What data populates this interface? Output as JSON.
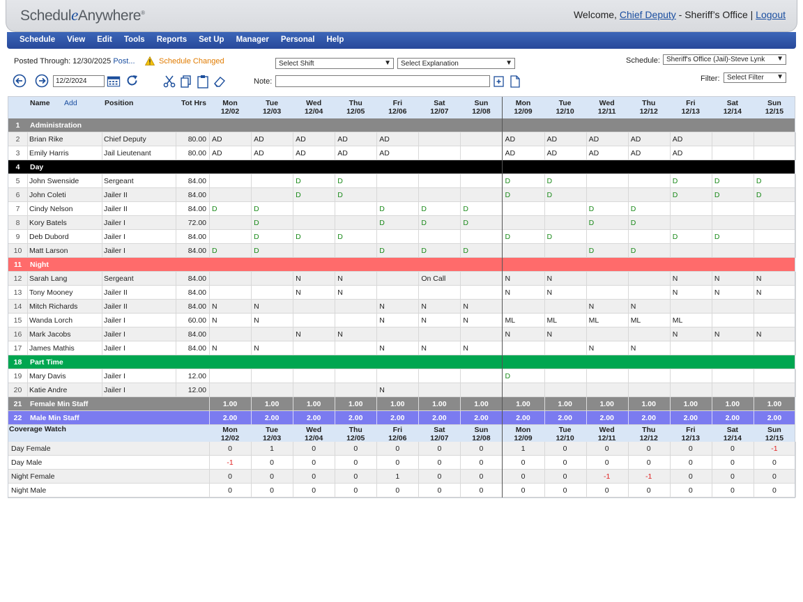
{
  "app": {
    "logo_main": "Schedul",
    "logo_e": "e",
    "logo_rest": "Anywhere",
    "logo_reg": "®",
    "welcome_prefix": "Welcome, ",
    "user_name": "Chief Deputy",
    "org_suffix": " - Sheriff’s Office | ",
    "logout": "Logout"
  },
  "menu": [
    "Schedule",
    "View",
    "Edit",
    "Tools",
    "Reports",
    "Set Up",
    "Manager",
    "Personal",
    "Help"
  ],
  "toolbar": {
    "posted_through_label": "Posted Through:",
    "posted_through_date": "12/30/2025",
    "post_link": "Post...",
    "warning_icon": "warning-icon",
    "schedule_changed": "Schedule Changed",
    "select_shift": "Select Shift",
    "select_explanation": "Select Explanation",
    "schedule_label": "Schedule:",
    "schedule_value": "Sheriff's Office (Jail)-Steve Lynk",
    "filter_label": "Filter:",
    "filter_value": "Select Filter",
    "date_value": "12/2/2024",
    "note_label": "Note:",
    "note_value": ""
  },
  "grid": {
    "headers": {
      "name": "Name",
      "add": "Add",
      "position": "Position",
      "tot_hrs": "Tot Hrs"
    },
    "days": [
      [
        "Mon",
        "12/02"
      ],
      [
        "Tue",
        "12/03"
      ],
      [
        "Wed",
        "12/04"
      ],
      [
        "Thu",
        "12/05"
      ],
      [
        "Fri",
        "12/06"
      ],
      [
        "Sat",
        "12/07"
      ],
      [
        "Sun",
        "12/08"
      ],
      [
        "Mon",
        "12/09"
      ],
      [
        "Tue",
        "12/10"
      ],
      [
        "Wed",
        "12/11"
      ],
      [
        "Thu",
        "12/12"
      ],
      [
        "Fri",
        "12/13"
      ],
      [
        "Sat",
        "12/14"
      ],
      [
        "Sun",
        "12/15"
      ]
    ],
    "rows": [
      {
        "type": "group",
        "num": "1",
        "label": "Administration",
        "color": "#888888"
      },
      {
        "type": "emp",
        "num": "2",
        "name": "Brian Rike",
        "position": "Chief Deputy",
        "hrs": "80.00",
        "cells": [
          "AD",
          "AD",
          "AD",
          "AD",
          "AD",
          "",
          "",
          "AD",
          "AD",
          "AD",
          "AD",
          "AD",
          "",
          ""
        ],
        "cls": ""
      },
      {
        "type": "emp",
        "num": "3",
        "name": "Emily Harris",
        "position": "Jail Lieutenant",
        "hrs": "80.00",
        "cells": [
          "AD",
          "AD",
          "AD",
          "AD",
          "AD",
          "",
          "",
          "AD",
          "AD",
          "AD",
          "AD",
          "AD",
          "",
          ""
        ],
        "cls": ""
      },
      {
        "type": "group",
        "num": "4",
        "label": "Day",
        "color": "#000000"
      },
      {
        "type": "emp",
        "num": "5",
        "name": "John Swenside",
        "position": "Sergeant",
        "hrs": "84.00",
        "cells": [
          "",
          "",
          "D",
          "D",
          "",
          "",
          "",
          "D",
          "D",
          "",
          "",
          "D",
          "D",
          "D"
        ],
        "cls": "green"
      },
      {
        "type": "emp",
        "num": "6",
        "name": "John Coleti",
        "position": "Jailer II",
        "hrs": "84.00",
        "cells": [
          "",
          "",
          "D",
          "D",
          "",
          "",
          "",
          "D",
          "D",
          "",
          "",
          "D",
          "D",
          "D"
        ],
        "cls": "green"
      },
      {
        "type": "emp",
        "num": "7",
        "name": "Cindy Nelson",
        "position": "Jailer II",
        "hrs": "84.00",
        "cells": [
          "D",
          "D",
          "",
          "",
          "D",
          "D",
          "D",
          "",
          "",
          "D",
          "D",
          "",
          "",
          ""
        ],
        "cls": "green"
      },
      {
        "type": "emp",
        "num": "8",
        "name": "Kory Batels",
        "position": "Jailer I",
        "hrs": "72.00",
        "cells": [
          "",
          "D",
          "",
          "",
          "D",
          "D",
          "D",
          "",
          "",
          "D",
          "D",
          "",
          "",
          ""
        ],
        "cls": "green"
      },
      {
        "type": "emp",
        "num": "9",
        "name": "Deb Dubord",
        "position": "Jailer I",
        "hrs": "84.00",
        "cells": [
          "",
          "D",
          "D",
          "D",
          "",
          "",
          "",
          "D",
          "D",
          "",
          "",
          "D",
          "D",
          ""
        ],
        "cls": "green"
      },
      {
        "type": "emp",
        "num": "10",
        "name": "Matt Larson",
        "position": "Jailer I",
        "hrs": "84.00",
        "cells": [
          "D",
          "D",
          "",
          "",
          "D",
          "D",
          "D",
          "",
          "",
          "D",
          "D",
          "",
          "",
          ""
        ],
        "cls": "green"
      },
      {
        "type": "group",
        "num": "11",
        "label": "Night",
        "color": "#ff6b6b"
      },
      {
        "type": "emp",
        "num": "12",
        "name": "Sarah Lang",
        "position": "Sergeant",
        "hrs": "84.00",
        "cells": [
          "",
          "",
          "N",
          "N",
          "",
          "On Call",
          "",
          "N",
          "N",
          "",
          "",
          "N",
          "N",
          "N"
        ],
        "cls": ""
      },
      {
        "type": "emp",
        "num": "13",
        "name": "Tony Mooney",
        "position": "Jailer II",
        "hrs": "84.00",
        "cells": [
          "",
          "",
          "N",
          "N",
          "",
          "",
          "",
          "N",
          "N",
          "",
          "",
          "N",
          "N",
          "N"
        ],
        "cls": ""
      },
      {
        "type": "emp",
        "num": "14",
        "name": "Mitch Richards",
        "position": "Jailer II",
        "hrs": "84.00",
        "cells": [
          "N",
          "N",
          "",
          "",
          "N",
          "N",
          "N",
          "",
          "",
          "N",
          "N",
          "",
          "",
          ""
        ],
        "cls": ""
      },
      {
        "type": "emp",
        "num": "15",
        "name": "Wanda Lorch",
        "position": "Jailer I",
        "hrs": "60.00",
        "cells": [
          "N",
          "N",
          "",
          "",
          "N",
          "N",
          "N",
          "ML",
          "ML",
          "ML",
          "ML",
          "ML",
          "",
          ""
        ],
        "cls": ""
      },
      {
        "type": "emp",
        "num": "16",
        "name": "Mark Jacobs",
        "position": "Jailer I",
        "hrs": "84.00",
        "cells": [
          "",
          "",
          "N",
          "N",
          "",
          "",
          "",
          "N",
          "N",
          "",
          "",
          "N",
          "N",
          "N"
        ],
        "cls": ""
      },
      {
        "type": "emp",
        "num": "17",
        "name": "James Mathis",
        "position": "Jailer I",
        "hrs": "84.00",
        "cells": [
          "N",
          "N",
          "",
          "",
          "N",
          "N",
          "N",
          "",
          "",
          "N",
          "N",
          "",
          "",
          ""
        ],
        "cls": ""
      },
      {
        "type": "group",
        "num": "18",
        "label": "Part Time",
        "color": "#00a650"
      },
      {
        "type": "emp",
        "num": "19",
        "name": "Mary Davis",
        "position": "Jailer I",
        "hrs": "12.00",
        "cells": [
          "",
          "",
          "",
          "",
          "",
          "",
          "",
          "D",
          "",
          "",
          "",
          "",
          "",
          ""
        ],
        "cls": "green"
      },
      {
        "type": "emp",
        "num": "20",
        "name": "Katie Andre",
        "position": "Jailer I",
        "hrs": "12.00",
        "cells": [
          "",
          "",
          "",
          "",
          "N",
          "",
          "",
          "",
          "",
          "",
          "",
          "",
          "",
          ""
        ],
        "cls": ""
      },
      {
        "type": "min",
        "num": "21",
        "label": "Female Min Staff",
        "color": "#8a8a8a",
        "cells": [
          "1.00",
          "1.00",
          "1.00",
          "1.00",
          "1.00",
          "1.00",
          "1.00",
          "1.00",
          "1.00",
          "1.00",
          "1.00",
          "1.00",
          "1.00",
          "1.00"
        ]
      },
      {
        "type": "min",
        "num": "22",
        "label": "Male Min Staff",
        "color": "#7b7bf0",
        "cells": [
          "2.00",
          "2.00",
          "2.00",
          "2.00",
          "2.00",
          "2.00",
          "2.00",
          "2.00",
          "2.00",
          "2.00",
          "2.00",
          "2.00",
          "2.00",
          "2.00"
        ]
      }
    ],
    "coverage_title": "Coverage Watch",
    "coverage": [
      {
        "label": "Day Female",
        "cells": [
          "0",
          "1",
          "0",
          "0",
          "0",
          "0",
          "0",
          "1",
          "0",
          "0",
          "0",
          "0",
          "0",
          "-1"
        ]
      },
      {
        "label": "Day Male",
        "cells": [
          "-1",
          "0",
          "0",
          "0",
          "0",
          "0",
          "0",
          "0",
          "0",
          "0",
          "0",
          "0",
          "0",
          "0"
        ]
      },
      {
        "label": "Night Female",
        "cells": [
          "0",
          "0",
          "0",
          "0",
          "1",
          "0",
          "0",
          "0",
          "0",
          "-1",
          "-1",
          "0",
          "0",
          "0"
        ]
      },
      {
        "label": "Night Male",
        "cells": [
          "0",
          "0",
          "0",
          "0",
          "0",
          "0",
          "0",
          "0",
          "0",
          "0",
          "0",
          "0",
          "0",
          "0"
        ]
      }
    ]
  }
}
